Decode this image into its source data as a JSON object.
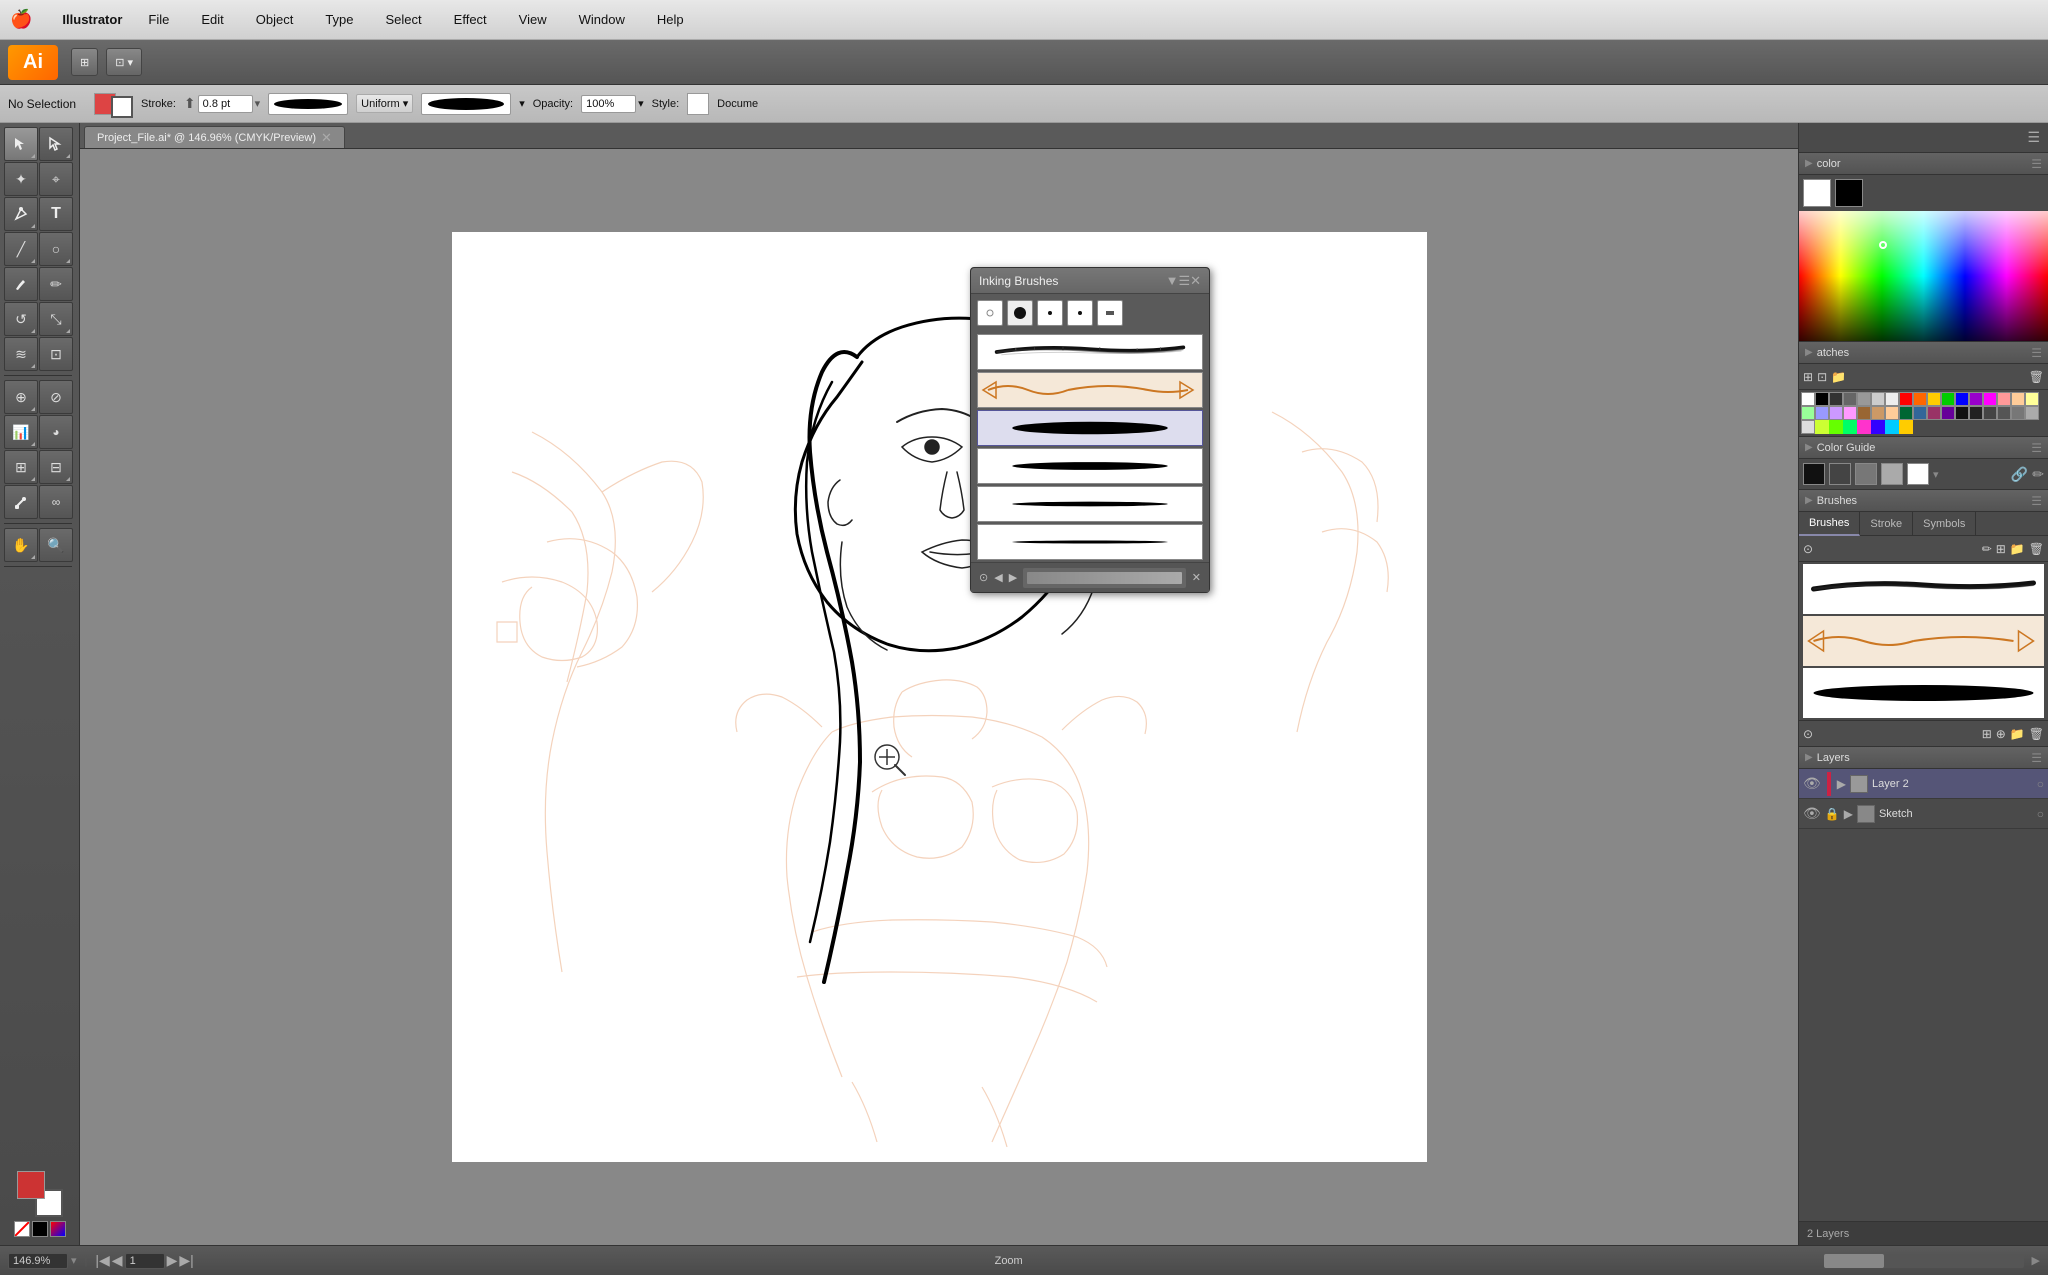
{
  "app": {
    "name": "Illustrator",
    "logo": "Ai"
  },
  "menubar": {
    "apple": "🍎",
    "items": [
      "Illustrator",
      "File",
      "Edit",
      "Object",
      "Type",
      "Select",
      "Effect",
      "View",
      "Window",
      "Help"
    ]
  },
  "toolbar": {
    "arrange_label": "⊞",
    "view_label": "⊡"
  },
  "options": {
    "no_selection": "No Selection",
    "stroke_label": "Stroke:",
    "stroke_value": "0.8 pt",
    "brush_type": "Uniform",
    "opacity_label": "Opacity:",
    "opacity_value": "100%",
    "style_label": "Style:",
    "document_label": "Docume"
  },
  "tab": {
    "close": "✕",
    "title": "Project_File.ai* @ 146.96% (CMYK/Preview)"
  },
  "floating_panel": {
    "title": "Inking Brushes",
    "close": "✕",
    "collapse": "—",
    "minimize": "▼"
  },
  "brush_dots": [
    "●",
    "●",
    "·",
    "·",
    " "
  ],
  "right_panel": {
    "color_title": "color",
    "swatches_title": "atches",
    "color_guide_title": "Color Guide",
    "brushes_title": "Brushes",
    "stroke_tab": "Stroke",
    "symbols_tab": "Symbols",
    "layers_title": "Layers",
    "layers_count": "2 Layers"
  },
  "layers": [
    {
      "name": "Layer 2",
      "color": "#cc2244",
      "visible": true,
      "locked": false
    },
    {
      "name": "Sketch",
      "color": "#888888",
      "visible": true,
      "locked": true
    }
  ],
  "status": {
    "zoom_value": "146.9%",
    "page_label": "Zoom",
    "page_current": "1",
    "zoom_text": "Zoom"
  }
}
